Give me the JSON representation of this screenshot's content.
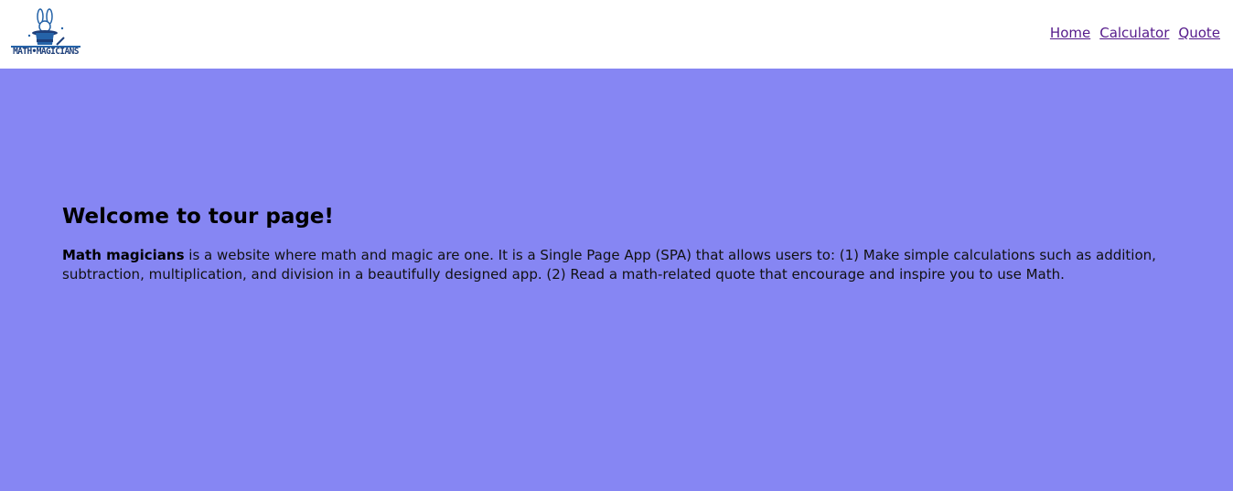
{
  "header": {
    "logo": {
      "text": "MATH•MAGICIANS",
      "icon": "magician-hat-rabbit-icon",
      "colors": {
        "primary": "#2563a8",
        "dark": "#1e3f7a"
      }
    },
    "nav": [
      {
        "label": "Home"
      },
      {
        "label": "Calculator"
      },
      {
        "label": "Quote"
      }
    ]
  },
  "main": {
    "background": "#8686f3",
    "title": "Welcome to tour page!",
    "description": {
      "bold": "Math magicians",
      "rest": " is a website where math and magic are one. It is a Single Page App (SPA) that allows users to: (1) Make simple calculations such as addition, subtraction, multiplication, and division in a beautifully designed app. (2) Read a math-related quote that encourage and inspire you to use Math."
    }
  }
}
